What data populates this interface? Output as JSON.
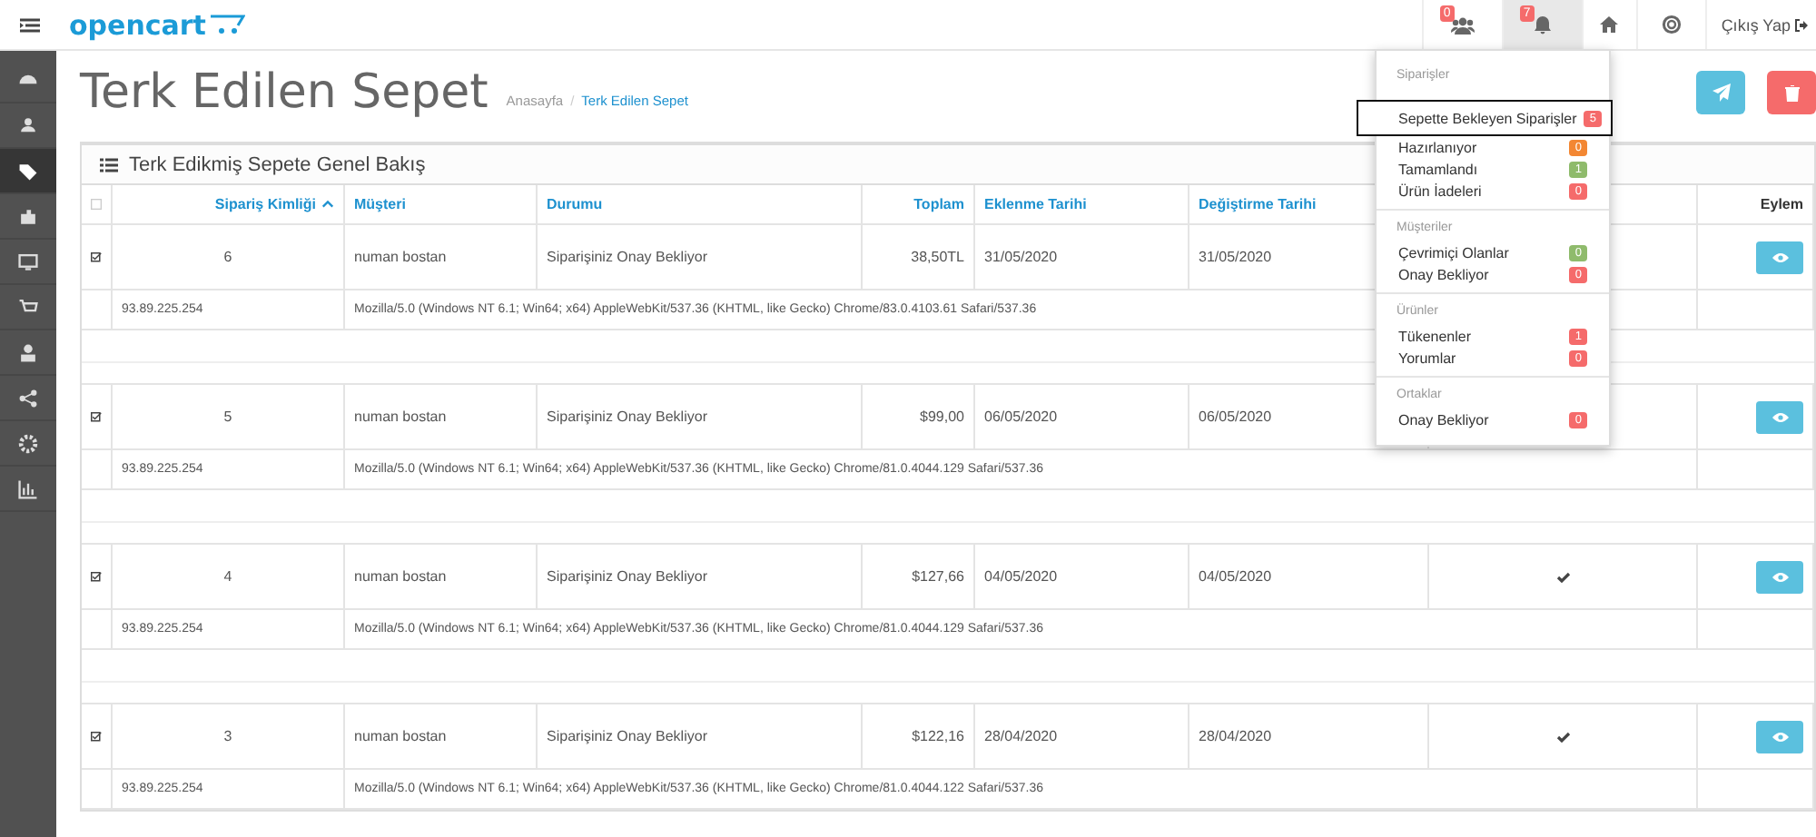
{
  "header": {
    "logo": "opencart",
    "notifications": [
      {
        "kind": "customers",
        "badge": "0",
        "active": false
      },
      {
        "kind": "alerts",
        "badge": "7",
        "active": true
      }
    ],
    "logout": "Çıkış Yap"
  },
  "sidebar": {
    "items": [
      {
        "selected": false
      },
      {
        "selected": false
      },
      {
        "selected": true
      },
      {
        "selected": false
      },
      {
        "selected": false
      },
      {
        "selected": false
      },
      {
        "selected": false
      },
      {
        "selected": false
      },
      {
        "selected": false
      },
      {
        "selected": false
      }
    ]
  },
  "page": {
    "title": "Terk Edilen Sepet",
    "breadcrumb": [
      "Anasayfa",
      "Terk Edilen Sepet"
    ],
    "breadcrumb_separator": "/"
  },
  "panel": {
    "title": "Terk Edikmiş Sepete Genel Bakış"
  },
  "table": {
    "select_all_checked": false,
    "columns": [
      {
        "kind": "checkbox"
      },
      {
        "label": "Sipariş Kimliği",
        "kind": "sorted"
      },
      {
        "label": "Müşteri",
        "kind": "text"
      },
      {
        "label": "Durumu",
        "kind": "text"
      },
      {
        "label": "Toplam",
        "kind": "right"
      },
      {
        "label": "Eklenme Tarihi",
        "kind": "text"
      },
      {
        "label": "Değiştirme Tarihi",
        "kind": "text"
      },
      {
        "kind": "hidden"
      },
      {
        "label": "Eylem",
        "kind": "right"
      }
    ],
    "rows": [
      {
        "checked": true,
        "id": "6",
        "customer": "numan bostan",
        "status": "Siparişiniz Onay Bekliyor",
        "total": "38,50TL",
        "added": "31/05/2020",
        "modified": "31/05/2020",
        "ip": "93.89.225.254",
        "user_agent": "Mozilla/5.0 (Windows NT 6.1; Win64; x64) AppleWebKit/537.36 (KHTML, like Gecko) Chrome/83.0.4103.61 Safari/537.36"
      },
      {
        "checked": true,
        "id": "5",
        "customer": "numan bostan",
        "status": "Siparişiniz Onay Bekliyor",
        "total": "$99,00",
        "added": "06/05/2020",
        "modified": "06/05/2020",
        "ip": "93.89.225.254",
        "user_agent": "Mozilla/5.0 (Windows NT 6.1; Win64; x64) AppleWebKit/537.36 (KHTML, like Gecko) Chrome/81.0.4044.129 Safari/537.36"
      },
      {
        "checked": true,
        "id": "4",
        "customer": "numan bostan",
        "status": "Siparişiniz Onay Bekliyor",
        "total": "$127,66",
        "added": "04/05/2020",
        "modified": "04/05/2020",
        "confirmed": true,
        "ip": "93.89.225.254",
        "user_agent": "Mozilla/5.0 (Windows NT 6.1; Win64; x64) AppleWebKit/537.36 (KHTML, like Gecko) Chrome/81.0.4044.129 Safari/537.36"
      },
      {
        "checked": true,
        "id": "3",
        "customer": "numan bostan",
        "status": "Siparişiniz Onay Bekliyor",
        "total": "$122,16",
        "added": "28/04/2020",
        "modified": "28/04/2020",
        "confirmed": true,
        "ip": "93.89.225.254",
        "user_agent": "Mozilla/5.0 (Windows NT 6.1; Win64; x64) AppleWebKit/537.36 (KHTML, like Gecko) Chrome/81.0.4044.122 Safari/537.36"
      }
    ]
  },
  "dropdown": {
    "sections": [
      {
        "title": "Siparişler",
        "items": [
          {
            "label": "Sepette Bekleyen Siparişler",
            "badge": "5",
            "color": "#f56b6b",
            "highlighted": true
          },
          {
            "label": "Hazırlanıyor",
            "badge": "0",
            "color": "#f38733",
            "highlighted": false
          },
          {
            "label": "Tamamlandı",
            "badge": "1",
            "color": "#8fbb6c",
            "highlighted": false
          },
          {
            "label": "Ürün İadeleri",
            "badge": "0",
            "color": "#f56b6b",
            "highlighted": false
          }
        ]
      },
      {
        "title": "Müşteriler",
        "items": [
          {
            "label": "Çevrimiçi Olanlar",
            "badge": "0",
            "color": "#8fbb6c",
            "highlighted": false
          },
          {
            "label": "Onay Bekliyor",
            "badge": "0",
            "color": "#f56b6b",
            "highlighted": false
          }
        ]
      },
      {
        "title": "Ürünler",
        "items": [
          {
            "label": "Tükenenler",
            "badge": "1",
            "color": "#f56b6b",
            "highlighted": false
          },
          {
            "label": "Yorumlar",
            "badge": "0",
            "color": "#f56b6b",
            "highlighted": false
          }
        ]
      },
      {
        "title": "Ortaklar",
        "items": [
          {
            "label": "Onay Bekliyor",
            "badge": "0",
            "color": "#f56b6b",
            "highlighted": false
          }
        ]
      }
    ]
  }
}
